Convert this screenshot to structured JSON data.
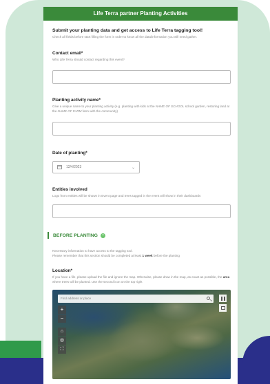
{
  "header": {
    "title": "Life Terra partner Planting Activities"
  },
  "intro": {
    "title": "Submit your planting data and get access to Life Terra tagging tool!",
    "description": "Check all fields before start filling the form in order to know all the data/information you will need gather."
  },
  "fields": {
    "contact_email": {
      "label": "Contact email*",
      "description": "Who Life Terra should contact regarding this event?",
      "value": ""
    },
    "activity_name": {
      "label": "Planting activity name*",
      "description_before": "Give a unique name to your planting activity (e.g. planting with kids at the ",
      "description_em1": "NAME OF SCHOOL",
      "description_mid": " school garden, restoring land at the ",
      "description_em2": "NAME OF FARM",
      "description_after": " farm with the community)",
      "value": ""
    },
    "date": {
      "label": "Date of planting*",
      "value": "12/4/2023"
    },
    "entities": {
      "label": "Entities involved",
      "description": "Logo from entities will be shown in Event page and trees tagged in the event will show in their dashboards",
      "value": ""
    },
    "location": {
      "label": "Location*",
      "description_before": "If you have a file, please upload the file and ignore the map. Otherwise, please draw in the map, as exact as possible, the ",
      "description_bold": "area",
      "description_after": " where trees will be planted. Use the second icon on the top right"
    }
  },
  "before_planting": {
    "title": "BEFORE PLANTING",
    "toggle_symbol": "−",
    "line1": "Necessary information to have access to the tagging tool.",
    "line2_before": "Please remember that this section should be completed at least ",
    "line2_bold": "1 week",
    "line2_after": " before the planting"
  },
  "map": {
    "search_placeholder": "Find address or place",
    "zoom_in": "+",
    "zoom_out": "−"
  },
  "icons": {
    "calendar": "calendar-icon",
    "chevron": "chevron-down-icon",
    "search": "search-icon",
    "home": "home-icon",
    "locate": "locate-icon",
    "fullscreen": "fullscreen-icon",
    "qr": "qr-code-icon",
    "draw": "draw-area-icon"
  },
  "colors": {
    "brand_green": "#3a8a3a",
    "accent_green": "#6cc46c",
    "navy": "#2a2f8a",
    "mint": "#cfe8d8"
  }
}
